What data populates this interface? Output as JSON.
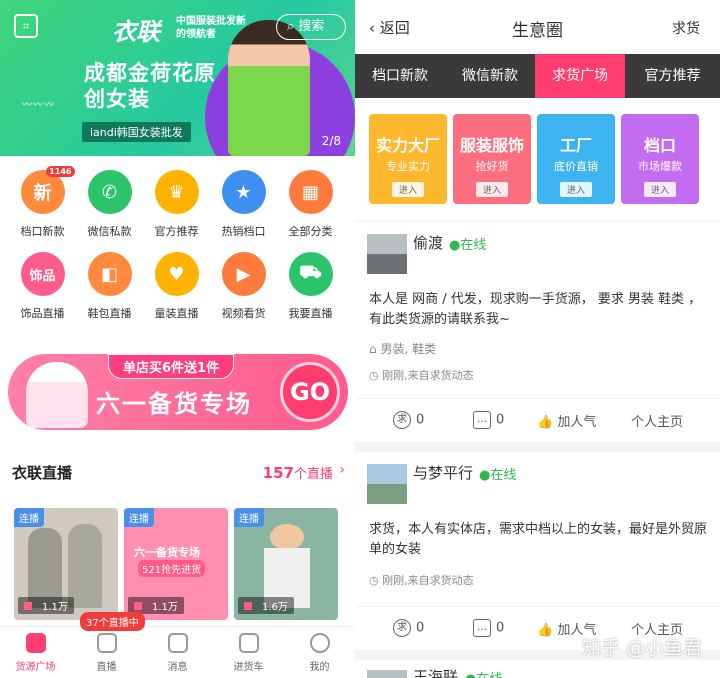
{
  "left": {
    "banner": {
      "logo": "衣联",
      "logo_sub": "中国服装批发新的领航者",
      "search": "搜索",
      "headline": "成都金荷花原创女装",
      "tag": "iandi韩国女装批发",
      "counter": "2/8"
    },
    "grid": [
      {
        "label": "档口新款",
        "glyph": "新",
        "color": "#ff8a3d",
        "badge": "1146"
      },
      {
        "label": "微信私款",
        "glyph": "✆",
        "color": "#2cc46b"
      },
      {
        "label": "官方推荐",
        "glyph": "♛",
        "color": "#ffb300"
      },
      {
        "label": "热销档口",
        "glyph": "★",
        "color": "#3d8ff0"
      },
      {
        "label": "全部分类",
        "glyph": "▦",
        "color": "#ff7a3d"
      },
      {
        "label": "饰品直播",
        "glyph": "饰品",
        "color": "#ff5b8d"
      },
      {
        "label": "鞋包直播",
        "glyph": "◧",
        "color": "#ff8a3d"
      },
      {
        "label": "童装直播",
        "glyph": "♥",
        "color": "#ffb300"
      },
      {
        "label": "视频看货",
        "glyph": "▶",
        "color": "#ff7a3d"
      },
      {
        "label": "我要直播",
        "glyph": "⛟",
        "color": "#2cc46b"
      }
    ],
    "promo": {
      "top": "单店买6件送1件",
      "main": "六一备货专场",
      "go": "GO"
    },
    "live": {
      "title": "衣联直播",
      "count": "157",
      "count_unit": "个直播",
      "arrow": "›"
    },
    "cards": [
      {
        "label": "连播",
        "views": "1.1万",
        "bg": "#cfc9c0"
      },
      {
        "label": "连播",
        "views": "1.1万",
        "bg": "#ff8fb0",
        "text1": "六一备货专场",
        "text2": "521抢先进货"
      },
      {
        "label": "连播",
        "views": "1.6万",
        "bg": "#8ab5a0"
      }
    ],
    "live_badge": "37个直播中",
    "tabs": [
      "货源广场",
      "直播",
      "消息",
      "进货车",
      "我的"
    ]
  },
  "right": {
    "back": "返回",
    "title": "生意圈",
    "request": "求货",
    "tabs": [
      "档口新款",
      "微信新款",
      "求货广场",
      "官方推荐"
    ],
    "active_tab": "求货广场",
    "categories": [
      {
        "title": "实力大厂",
        "sub": "专业实力",
        "btn": "进入",
        "color": "#ffb82e"
      },
      {
        "title": "服装服饰",
        "sub": "抢好货",
        "btn": "进入",
        "color": "#ff6e7f"
      },
      {
        "title": "工厂",
        "sub": "底价直销",
        "btn": "进入",
        "color": "#3db4f0"
      },
      {
        "title": "档口",
        "sub": "市场爆款",
        "btn": "进入",
        "color": "#c46cf0"
      }
    ],
    "posts": [
      {
        "name": "偷渡",
        "online": "●在线",
        "body": "本人是 网商 / 代发，现求购一手货源， 要求 男装 鞋类 ，有此类货源的请联系我~",
        "tags": "男装, 鞋类",
        "meta": "刚刚,来自求货动态",
        "req_count": "0",
        "comment_count": "0",
        "like": "加人气",
        "home": "个人主页"
      },
      {
        "name": "与梦平行",
        "online": "●在线",
        "body": "求货，本人有实体店，需求中档以上的女装，最好是外贸原单的女装",
        "meta": "刚刚,来自求货动态",
        "req_count": "0",
        "comment_count": "0",
        "like": "加人气",
        "home": "个人主页"
      },
      {
        "name": "王海联",
        "online": "●在线"
      }
    ],
    "watermark": "知乎 @小鱼君"
  }
}
